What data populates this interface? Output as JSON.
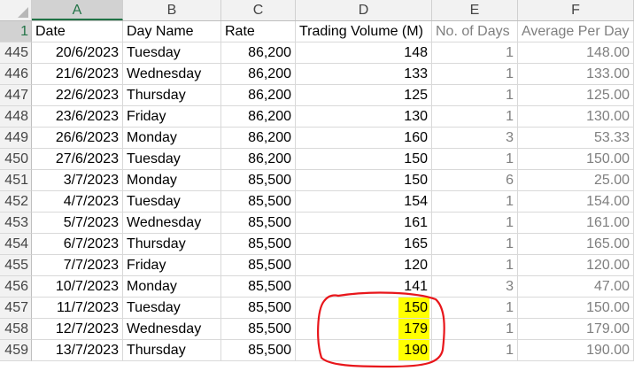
{
  "columns": [
    "A",
    "B",
    "C",
    "D",
    "E",
    "F"
  ],
  "header": {
    "row_number": "1",
    "cells": [
      "Date",
      "Day Name",
      "Rate",
      "Trading Volume (M)",
      "No. of Days",
      "Average Per Day"
    ]
  },
  "rows": [
    {
      "num": "445",
      "date": "20/6/2023",
      "day": "Tuesday",
      "rate": "86,200",
      "volume": "148",
      "days": "1",
      "avg": "148.00"
    },
    {
      "num": "446",
      "date": "21/6/2023",
      "day": "Wednesday",
      "rate": "86,200",
      "volume": "133",
      "days": "1",
      "avg": "133.00"
    },
    {
      "num": "447",
      "date": "22/6/2023",
      "day": "Thursday",
      "rate": "86,200",
      "volume": "125",
      "days": "1",
      "avg": "125.00"
    },
    {
      "num": "448",
      "date": "23/6/2023",
      "day": "Friday",
      "rate": "86,200",
      "volume": "130",
      "days": "1",
      "avg": "130.00"
    },
    {
      "num": "449",
      "date": "26/6/2023",
      "day": "Monday",
      "rate": "86,200",
      "volume": "160",
      "days": "3",
      "avg": "53.33"
    },
    {
      "num": "450",
      "date": "27/6/2023",
      "day": "Tuesday",
      "rate": "86,200",
      "volume": "150",
      "days": "1",
      "avg": "150.00"
    },
    {
      "num": "451",
      "date": "3/7/2023",
      "day": "Monday",
      "rate": "85,500",
      "volume": "150",
      "days": "6",
      "avg": "25.00"
    },
    {
      "num": "452",
      "date": "4/7/2023",
      "day": "Tuesday",
      "rate": "85,500",
      "volume": "154",
      "days": "1",
      "avg": "154.00"
    },
    {
      "num": "453",
      "date": "5/7/2023",
      "day": "Wednesday",
      "rate": "85,500",
      "volume": "161",
      "days": "1",
      "avg": "161.00"
    },
    {
      "num": "454",
      "date": "6/7/2023",
      "day": "Thursday",
      "rate": "85,500",
      "volume": "165",
      "days": "1",
      "avg": "165.00"
    },
    {
      "num": "455",
      "date": "7/7/2023",
      "day": "Friday",
      "rate": "85,500",
      "volume": "120",
      "days": "1",
      "avg": "120.00"
    },
    {
      "num": "456",
      "date": "10/7/2023",
      "day": "Monday",
      "rate": "85,500",
      "volume": "141",
      "days": "3",
      "avg": "47.00"
    },
    {
      "num": "457",
      "date": "11/7/2023",
      "day": "Tuesday",
      "rate": "85,500",
      "volume": "150",
      "days": "1",
      "avg": "150.00",
      "highlight": true
    },
    {
      "num": "458",
      "date": "12/7/2023",
      "day": "Wednesday",
      "rate": "85,500",
      "volume": "179",
      "days": "1",
      "avg": "179.00",
      "highlight": true
    },
    {
      "num": "459",
      "date": "13/7/2023",
      "day": "Thursday",
      "rate": "85,500",
      "volume": "190",
      "days": "1",
      "avg": "190.00",
      "highlight": true
    }
  ],
  "colors": {
    "highlight": "#ffff00",
    "annotation": "#e8161b",
    "header_bg": "#f2f2f2",
    "active_header": "#217346",
    "grey_text": "#7f7f7f"
  },
  "active": {
    "column": "A",
    "row": "1"
  }
}
